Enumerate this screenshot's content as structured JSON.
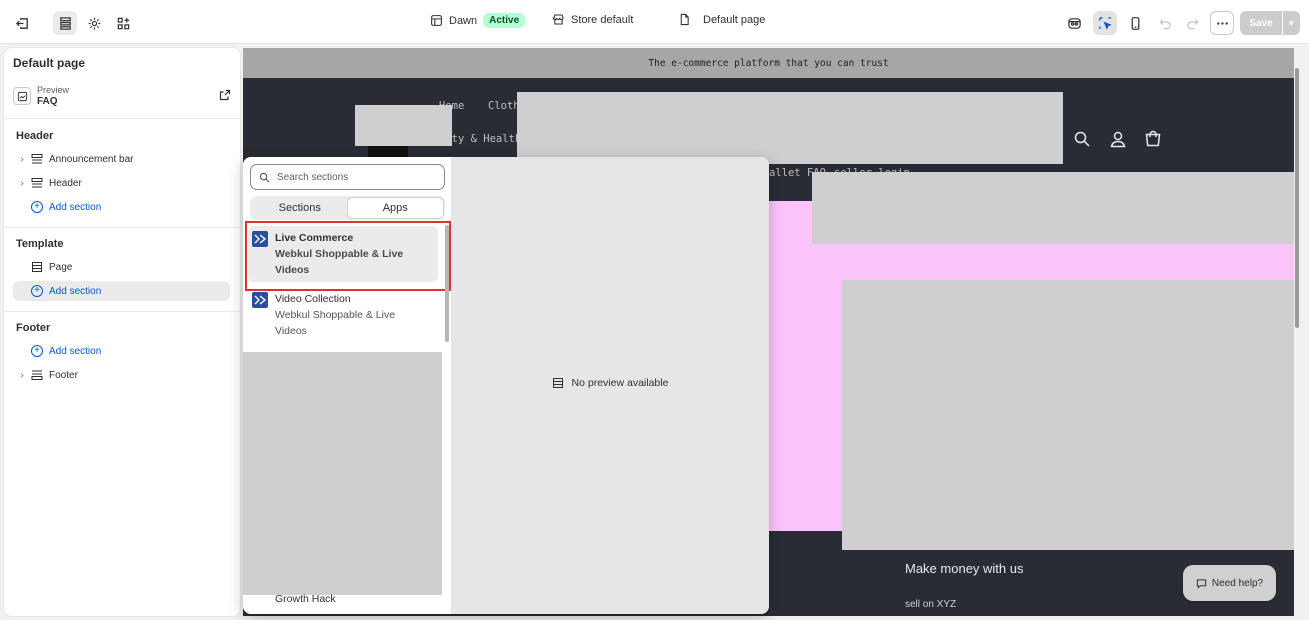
{
  "topbar": {
    "theme_name": "Dawn",
    "theme_status": "Active",
    "store": "Store default",
    "page": "Default page",
    "save_label": "Save"
  },
  "sidebar": {
    "title": "Default page",
    "preview_label": "Preview",
    "preview_value": "FAQ",
    "groups": {
      "header": "Header",
      "template": "Template",
      "footer": "Footer"
    },
    "header_items": [
      "Announcement bar",
      "Header"
    ],
    "template_items": [
      "Page"
    ],
    "footer_items": [
      "Footer"
    ],
    "add_section": "Add section"
  },
  "canvas": {
    "announcement": "The e-commerce platform that you can trust",
    "nav": {
      "home": "Home",
      "clothing": "Cloth",
      "beauty": "auty & Health",
      "wallet": "allet FAQ",
      "seller": "seller login"
    },
    "footer_title": "Make money with us",
    "footer_link": "sell on XYZ",
    "help": "Need help?"
  },
  "picker": {
    "search_placeholder": "Search sections",
    "tabs": [
      "Sections",
      "Apps"
    ],
    "selected_tab": "Apps",
    "apps": [
      {
        "name": "Live Commerce",
        "vendor_line1": "Webkul Shoppable & Live",
        "vendor_line2": "Videos"
      },
      {
        "name": "Video Collection",
        "vendor_line1": "Webkul Shoppable & Live",
        "vendor_line2": "Videos"
      }
    ],
    "trailing_item": "Growth Hack",
    "no_preview": "No preview available"
  },
  "colors": {
    "accent_link": "#005bd3",
    "active_badge": "#b4fed2",
    "highlight_border": "#e03131",
    "store_header": "#2a2c35",
    "pink_banner": "#fbc4fb"
  }
}
